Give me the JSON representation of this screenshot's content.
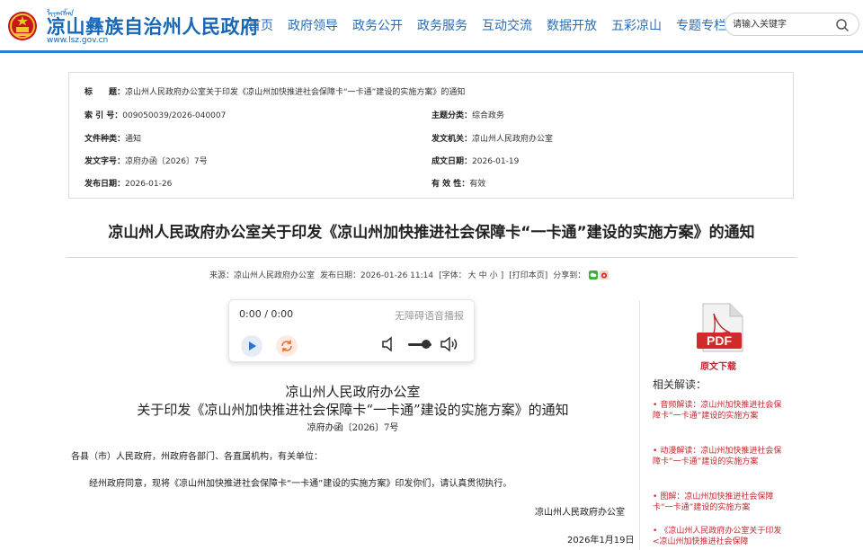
{
  "header": {
    "mongol_script": "ᠯᠢᠶᠠᠩᠱᠠᠨ",
    "site_title": "凉山彝族自治州人民政府",
    "site_url": "www.lsz.gov.cn",
    "nav": [
      "首页",
      "政府领导",
      "政务公开",
      "政务服务",
      "互动交流",
      "数据开放",
      "五彩凉山",
      "专题专栏"
    ],
    "search_placeholder": "请输入关键字",
    "accent_color": "#1767b8"
  },
  "meta": {
    "title_key": "标　　题：",
    "title_value": "凉山州人民政府办公室关于印发《凉山州加快推进社会保障卡“一卡通”建设的实施方案》的通知",
    "index_key": "索 引 号：",
    "index_value": "009050039/2026-040007",
    "category_key": "主题分类：",
    "category_value": "综合政务",
    "doctype_key": "文件种类：",
    "doctype_value": "通知",
    "issuer_key": "发文机关：",
    "issuer_value": "凉山州人民政府办公室",
    "docno_key": "发文字号：",
    "docno_value": "凉府办函〔2026〕7号",
    "created_key": "成文日期：",
    "created_value": "2026-01-19",
    "published_key": "发布日期：",
    "published_value": "2026-01-26",
    "validity_key": "有 效 性：",
    "validity_value": "有效"
  },
  "article": {
    "title": "凉山州人民政府办公室关于印发《凉山州加快推进社会保障卡“一卡通”建设的实施方案》的通知",
    "source": "来源：凉山州人民政府办公室",
    "publish_time": "发布日期：2026-01-26 11:14",
    "font_label": "[字体：",
    "font_large": "大",
    "font_medium": "中",
    "font_small": "小",
    "font_close": "]",
    "print_label": "[打印本页]",
    "share_label": "分享到："
  },
  "player": {
    "time": "0:00 / 0:00",
    "label": "无障碍语音播报",
    "volume_level": 0.85
  },
  "document": {
    "issuer": "凉山州人民政府办公室",
    "heading": "关于印发《凉山州加快推进社会保障卡“一卡通”建设的实施方案》的通知",
    "number": "凉府办函〔2026〕7号",
    "addressee": "各县（市）人民政府，州政府各部门、各直属机构，有关单位：",
    "paragraph": "经州政府同意，现将《凉山州加快推进社会保障卡“一卡通”建设的实施方案》印发你们，请认真贯彻执行。",
    "signature": "凉山州人民政府办公室",
    "date": "2026年1月19日"
  },
  "sidebar": {
    "pdf_text": "PDF",
    "download_label": "原文下载",
    "related_title": "相关解读：",
    "related": [
      "音频解读：凉山州加快推进社会保障卡“一卡通”建设的实施方案",
      "动漫解读：凉山州加快推进社会保障卡“一卡通”建设的实施方案",
      "图解：凉山州加快推进社会保障卡“一卡通”建设的实施方案",
      "《凉山州人民政府办公室关于印发<凉山州加快推进社会保障"
    ],
    "link_color": "#c0282e"
  }
}
